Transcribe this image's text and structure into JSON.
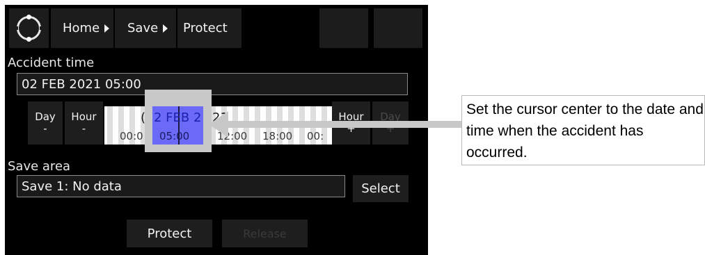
{
  "header": {
    "breadcrumbs": [
      {
        "label": "Home"
      },
      {
        "label": "Save"
      },
      {
        "label": "Protect"
      }
    ]
  },
  "accident": {
    "title": "Accident time",
    "value": "02 FEB 2021 05:00"
  },
  "timeline": {
    "day_minus": {
      "line1": "Day",
      "line2": "-"
    },
    "hour_minus": {
      "line1": "Hour",
      "line2": "-"
    },
    "hour_plus": {
      "line1": "Hour",
      "line2": "+"
    },
    "day_plus": {
      "line1": "Day",
      "line2": "+"
    },
    "date_left": "(",
    "date_center": "2 FEB 2",
    "date_right": "21",
    "times": [
      "00:0",
      "05:00",
      "12:00",
      "18:00",
      "00:"
    ]
  },
  "save_area": {
    "title": "Save area",
    "value": "Save 1: No data",
    "select_label": "Select"
  },
  "actions": {
    "protect_label": "Protect",
    "release_label": "Release"
  },
  "callout": {
    "text": "Set the cursor center to the date and time when the accident has occurred."
  },
  "colors": {
    "panel": "#000000",
    "cursor": "#6a6af7",
    "highlight": "#c8c8c8"
  }
}
